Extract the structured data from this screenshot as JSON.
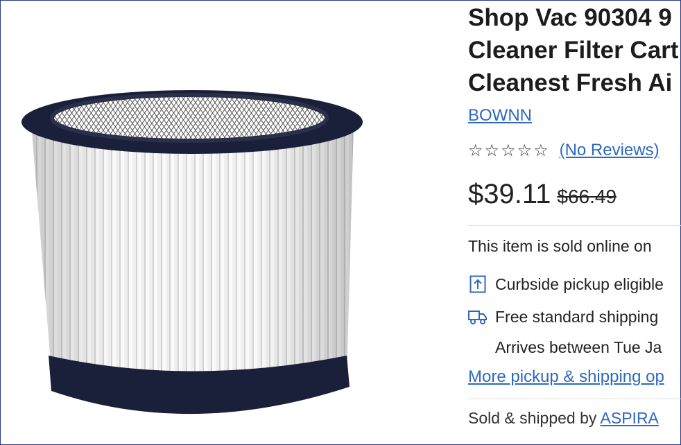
{
  "product": {
    "title_lines": [
      "Shop Vac 90304 9",
      "Cleaner Filter Cart",
      "Cleanest Fresh Ai"
    ],
    "brand": "BOWNN",
    "rating": {
      "stars_filled": 0,
      "stars_total": 5,
      "reviews_label": "(No Reviews)"
    },
    "price": "$39.11",
    "original_price": "$66.49",
    "sold_online_text": "This item is sold online on",
    "fulfillment": {
      "curbside": "Curbside pickup eligible",
      "shipping": "Free standard shipping",
      "arrives": "Arrives between Tue Ja"
    },
    "more_options_link": "More pickup & shipping op",
    "sold_by_prefix": "Sold & shipped by ",
    "seller": "ASPIRA"
  },
  "icons": {
    "curbside": "curbside-pickup-icon",
    "shipping": "shipping-truck-icon",
    "star": "star-outline-icon"
  },
  "colors": {
    "link": "#2e68c0",
    "text": "#1f1f1f",
    "divider": "#dcdcdc"
  }
}
